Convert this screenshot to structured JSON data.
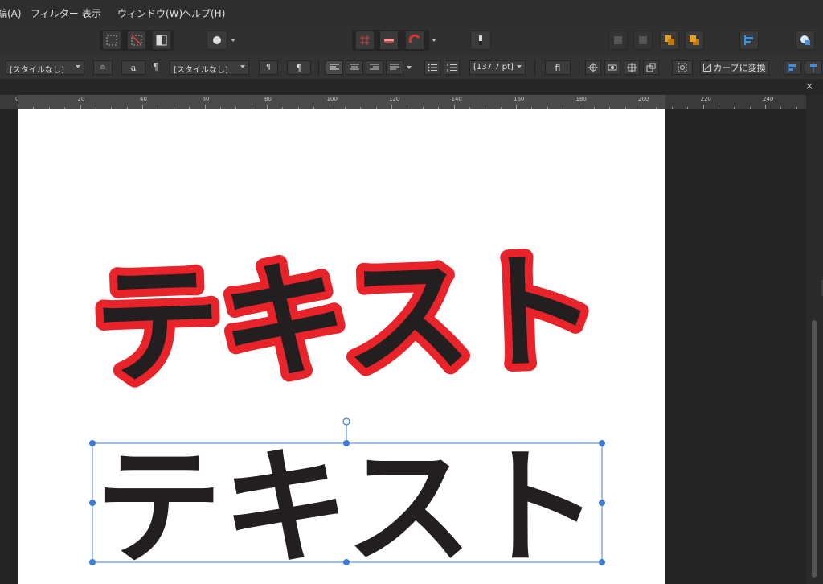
{
  "menu": [
    "編(A)",
    "フィルター",
    "表示",
    "ウィンドウ(W)",
    "ヘルプ(H)"
  ],
  "context_bar": {
    "char_style": "[スタイルなし]",
    "char_button": "a",
    "para_icon": "¶",
    "para_style": "[スタイルなし]",
    "para_button": "¶",
    "font_size": "[137.7 pt]",
    "ligature_button": "ﬁ",
    "convert_to_curves": "カーブに変換"
  },
  "ruler": {
    "labels": [
      "0",
      "20",
      "40",
      "60",
      "80",
      "100",
      "120",
      "140",
      "160",
      "180",
      "200",
      "220",
      "240"
    ]
  },
  "document": {
    "text_outlined": "テキスト",
    "text_plain": "テキスト",
    "text_color": "#231f20",
    "stroke_color": "#e8232a"
  },
  "selection_color": "#3b7dd8",
  "close_icon": "×"
}
